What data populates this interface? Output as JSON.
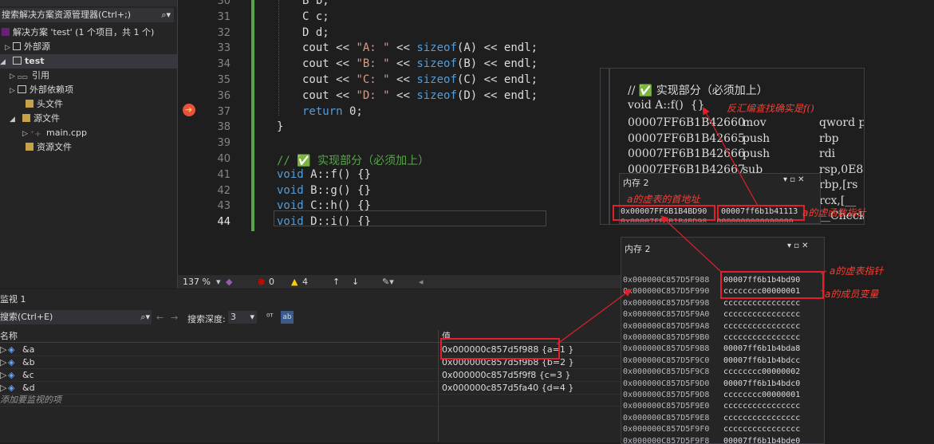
{
  "solution_explorer": {
    "search_placeholder": "搜索解决方案资源管理器(Ctrl+;)",
    "items": [
      {
        "label": "解决方案 'test' (1 个项目，共 1 个)"
      },
      {
        "label": "外部源"
      },
      {
        "label": "test"
      },
      {
        "label": "引用"
      },
      {
        "label": "外部依赖项"
      },
      {
        "label": "头文件"
      },
      {
        "label": "源文件"
      },
      {
        "label": "main.cpp"
      },
      {
        "label": "资源文件"
      }
    ]
  },
  "editor": {
    "lines": [
      {
        "num": "30",
        "text": "B b;"
      },
      {
        "num": "31",
        "text": "C c;"
      },
      {
        "num": "32",
        "text": "D d;"
      },
      {
        "num": "33",
        "pre": "cout << ",
        "str": "\"A: \"",
        "mid": " << ",
        "fn": "sizeof",
        "arg": "(A)",
        "post": " << endl;"
      },
      {
        "num": "34",
        "pre": "cout << ",
        "str": "\"B: \"",
        "mid": " << ",
        "fn": "sizeof",
        "arg": "(B)",
        "post": " << endl;"
      },
      {
        "num": "35",
        "pre": "cout << ",
        "str": "\"C: \"",
        "mid": " << ",
        "fn": "sizeof",
        "arg": "(C)",
        "post": " << endl;"
      },
      {
        "num": "36",
        "pre": "cout << ",
        "str": "\"D: \"",
        "mid": " << ",
        "fn": "sizeof",
        "arg": "(D)",
        "post": " << endl;"
      },
      {
        "num": "37",
        "kw": "return",
        "text": " 0;"
      },
      {
        "num": "38",
        "text": "}"
      },
      {
        "num": "39",
        "text": ""
      },
      {
        "num": "40",
        "comment": "// ✅ 实现部分（必须加上）"
      },
      {
        "num": "41",
        "kw": "void",
        "text": " A::f() {}"
      },
      {
        "num": "42",
        "kw": "void",
        "text": " B::g() {}"
      },
      {
        "num": "43",
        "kw": "void",
        "text": " C::h() {}"
      },
      {
        "num": "44",
        "kw": "void",
        "text": " D::i() {}"
      }
    ]
  },
  "status": {
    "zoom": "137 %",
    "errors": "0",
    "warnings": "4"
  },
  "watch": {
    "title": "监视 1",
    "search_placeholder": "搜索(Ctrl+E)",
    "depth_label": "搜索深度:",
    "depth_value": "3",
    "col_name": "名称",
    "col_value": "值",
    "rows": [
      {
        "name": "&a",
        "value": "0x000000c857d5f988 {a=1 }"
      },
      {
        "name": "&b",
        "value": "0x000000c857d5f9b8 {b=2 }"
      },
      {
        "name": "&c",
        "value": "0x000000c857d5f9f8 {c=3 }"
      },
      {
        "name": "&d",
        "value": "0x000000c857d5fa40 {d=4 }"
      }
    ],
    "add_item": "添加要监视的项"
  },
  "disassembly": {
    "comment": "// ✅ 实现部分（必须加上）",
    "func_line": "void A::f()  {}",
    "annotation": "反汇编查找确实是f()",
    "rows": [
      {
        "addr": "00007FF6B1B42660",
        "op": "mov",
        "arg": "qword p"
      },
      {
        "addr": "00007FF6B1B42665",
        "op": "push",
        "arg": "rbp"
      },
      {
        "addr": "00007FF6B1B42666",
        "op": "push",
        "arg": "rdi"
      },
      {
        "addr": "00007FF6B1B42667",
        "op": "sub",
        "arg": "rsp,0E8"
      },
      {
        "addr": "",
        "op": "",
        "arg": "rbp,[rs"
      },
      {
        "addr": "",
        "op": "",
        "arg": "rcx,[__"
      },
      {
        "addr": "",
        "op": "",
        "arg": "__Check"
      }
    ]
  },
  "memory_small": {
    "title": "内存 2",
    "annotation_top": "a的虚表的首地址",
    "annotation_right": "a的虚函数指针",
    "row_addr": "0x00007FF6B1B4BD90",
    "row_val": "00007ff6b1b41113",
    "row2": "0x00007FF6B1B4BD98  0000000000000000"
  },
  "memory_big": {
    "title": "内存 2",
    "annotation_vptr": "a的虚表指针",
    "annotation_member": "a的成员变量",
    "rows": [
      {
        "addr": "0x000000C857D5F988",
        "val": "00007ff6b1b4bd90"
      },
      {
        "addr": "0x000000C857D5F990",
        "val": "cccccccc00000001"
      },
      {
        "addr": "0x000000C857D5F998",
        "val": "cccccccccccccccc"
      },
      {
        "addr": "0x000000C857D5F9A0",
        "val": "cccccccccccccccc"
      },
      {
        "addr": "0x000000C857D5F9A8",
        "val": "cccccccccccccccc"
      },
      {
        "addr": "0x000000C857D5F9B0",
        "val": "cccccccccccccccc"
      },
      {
        "addr": "0x000000C857D5F9B8",
        "val": "00007ff6b1b4bda8"
      },
      {
        "addr": "0x000000C857D5F9C0",
        "val": "00007ff6b1b4bdcc"
      },
      {
        "addr": "0x000000C857D5F9C8",
        "val": "cccccccc00000002"
      },
      {
        "addr": "0x000000C857D5F9D0",
        "val": "00007ff6b1b4bdc0"
      },
      {
        "addr": "0x000000C857D5F9D8",
        "val": "cccccccc00000001"
      },
      {
        "addr": "0x000000C857D5F9E0",
        "val": "cccccccccccccccc"
      },
      {
        "addr": "0x000000C857D5F9E8",
        "val": "cccccccccccccccc"
      },
      {
        "addr": "0x000000C857D5F9F0",
        "val": "cccccccccccccccc"
      },
      {
        "addr": "0x000000C857D5F9F8",
        "val": "00007ff6b1b4bde0"
      }
    ]
  },
  "colors": {
    "accent_red": "#e0202a",
    "comment_green": "#57a64a",
    "keyword_blue": "#569cd6"
  }
}
